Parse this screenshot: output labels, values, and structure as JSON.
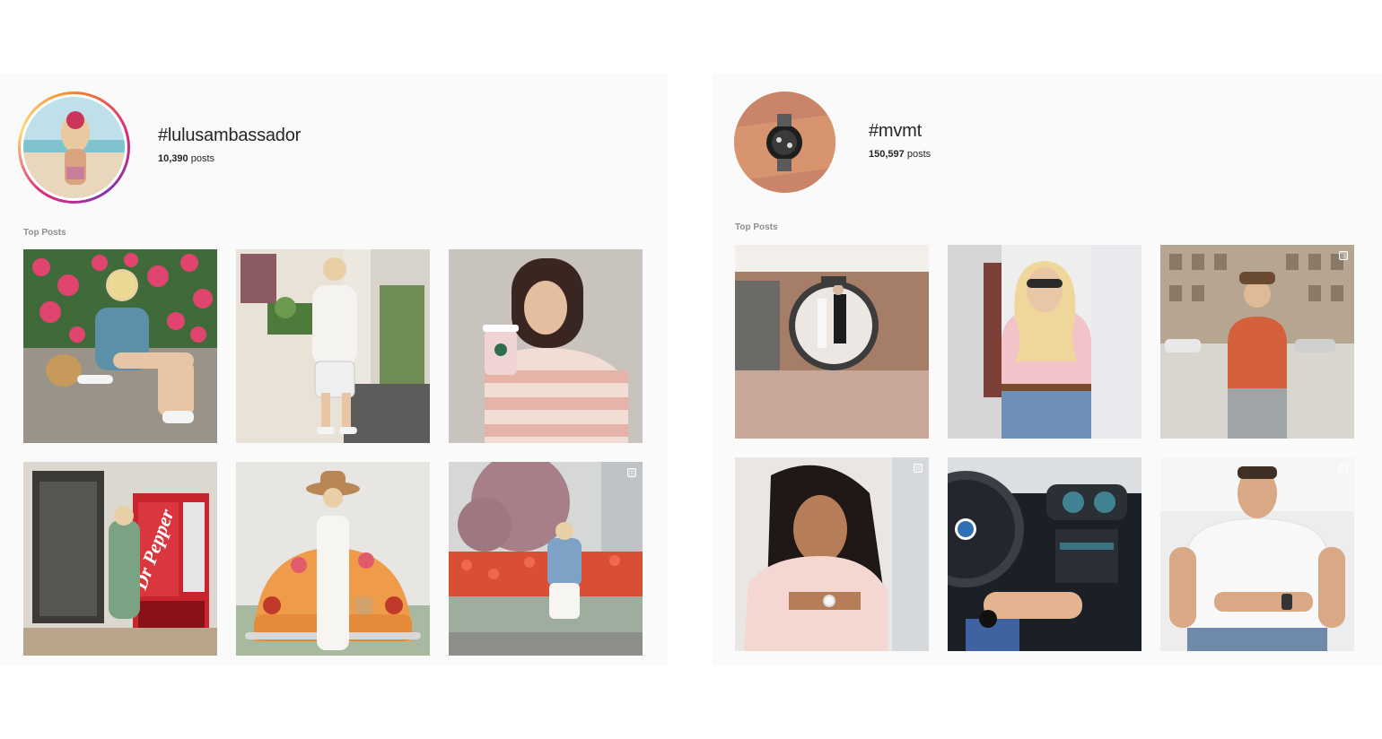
{
  "left": {
    "hashtag": "#lulusambassador",
    "post_count": "10,390",
    "post_count_suffix": "posts",
    "section_label": "Top Posts",
    "posts": [
      {
        "icon": "photo-icon"
      },
      {
        "icon": "photo-icon"
      },
      {
        "icon": "photo-icon"
      },
      {
        "icon": "photo-icon",
        "sign_text": "Dr Pepper"
      },
      {
        "icon": "photo-icon"
      },
      {
        "icon": "photo-icon"
      }
    ]
  },
  "right": {
    "hashtag": "#mvmt",
    "post_count": "150,597",
    "post_count_suffix": "posts",
    "section_label": "Top Posts",
    "posts": [
      {
        "icon": "photo-icon"
      },
      {
        "icon": "photo-icon"
      },
      {
        "icon": "photo-icon"
      },
      {
        "icon": "photo-icon"
      },
      {
        "icon": "photo-icon"
      },
      {
        "icon": "photo-icon"
      }
    ]
  },
  "colors": {
    "panel_bg": "#fafafa",
    "text": "#262626",
    "muted": "#8e8e8e",
    "story_ring_start": "#f58529",
    "story_ring_end": "#dd2a7b"
  }
}
